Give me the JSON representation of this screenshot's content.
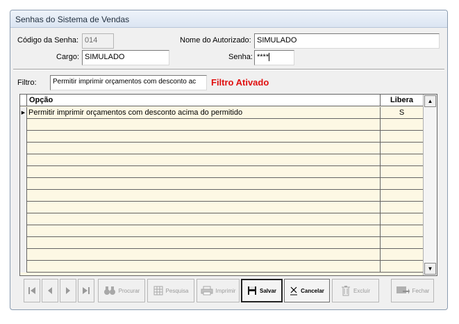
{
  "window": {
    "title": "Senhas do Sistema de Vendas"
  },
  "form": {
    "codigo_label": "Código da Senha:",
    "codigo_value": "014",
    "autorizado_label": "Nome do Autorizado:",
    "autorizado_value": "SIMULADO",
    "cargo_label": "Cargo:",
    "cargo_value": "SIMULADO",
    "senha_label": "Senha:",
    "senha_value": "****"
  },
  "filter": {
    "label": "Filtro:",
    "value": "Permitir imprimir orçamentos com desconto ac",
    "status": "Filtro Ativado"
  },
  "grid": {
    "col_opcao": "Opção",
    "col_libera": "Libera",
    "rows": [
      {
        "opcao": "Permitir imprimir orçamentos com desconto acima do permitido",
        "libera": "S"
      }
    ]
  },
  "toolbar": {
    "procurar": "Procurar",
    "pesquisa": "Pesquisa",
    "imprimir": "Imprimir",
    "salvar": "Salvar",
    "cancelar": "Cancelar",
    "excluir": "Excluir",
    "fechar": "Fechar"
  },
  "icons": [
    "first-record-icon",
    "prev-record-icon",
    "next-record-icon",
    "last-record-icon",
    "binoculars-icon",
    "grid-icon",
    "printer-icon",
    "floppy-disk-icon",
    "cancel-x-icon",
    "trash-icon",
    "exit-icon"
  ]
}
